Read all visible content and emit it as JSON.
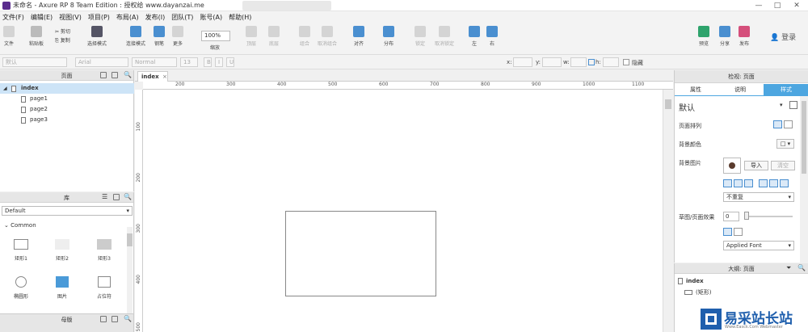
{
  "window": {
    "title": "未命名 - Axure RP 8 Team Edition : 授权给 www.dayanzai.me",
    "controls": [
      "—",
      "□",
      "✕"
    ]
  },
  "menu": [
    "文件(F)",
    "编辑(E)",
    "视图(V)",
    "项目(P)",
    "布局(A)",
    "发布(I)",
    "团队(T)",
    "账号(A)",
    "帮助(H)"
  ],
  "toolbar": {
    "file": "文件",
    "paste": "粘贴板",
    "cut": "剪切",
    "copy": "复制",
    "select": "选择模式",
    "connect": "连接模式",
    "pen": "钢笔",
    "more": "更多",
    "zoom_value": "100%",
    "zoom_label": "缩放",
    "top": "顶层",
    "bottom": "底层",
    "group": "组合",
    "ungroup": "取消组合",
    "align": "对齐",
    "distribute": "分布",
    "lock": "锁定",
    "unlock": "取消锁定",
    "left": "左",
    "right": "右",
    "preview": "预览",
    "share": "分享",
    "publish": "发布",
    "login": "登录"
  },
  "format_bar": {
    "style": "默认",
    "font": "Arial",
    "weight": "Normal",
    "size": "13",
    "x": "x:",
    "y": "y:",
    "w": "w:",
    "h": "h:",
    "hidden": "隐藏"
  },
  "pages_panel": {
    "title": "页面",
    "items": [
      {
        "label": "index",
        "level": 0,
        "selected": true
      },
      {
        "label": "page1",
        "level": 1
      },
      {
        "label": "page2",
        "level": 1
      },
      {
        "label": "page3",
        "level": 1
      }
    ]
  },
  "library_panel": {
    "title": "库",
    "selected_library": "Default",
    "group": "Common",
    "widgets": [
      "矩形1",
      "矩形2",
      "矩形3",
      "椭圆形",
      "图片",
      "占位符"
    ]
  },
  "masters_panel": {
    "title": "母版"
  },
  "canvas": {
    "tab_label": "index",
    "h_ruler": [
      "200",
      "300",
      "400",
      "500",
      "600",
      "700",
      "800",
      "900",
      "1000",
      "1100"
    ],
    "v_ruler": [
      "100",
      "200",
      "300",
      "400",
      "500"
    ]
  },
  "inspector": {
    "title": "检视: 页面",
    "tabs": [
      "属性",
      "说明",
      "样式"
    ],
    "active_tab": "样式",
    "style_name": "默认",
    "page_align_label": "页面排列",
    "bg_color_label": "背景颜色",
    "bg_image_label": "背景图片",
    "import_button": "导入",
    "clear_button": "清空",
    "repeat_option": "不重复",
    "sketch_label": "草图/页面效果",
    "sketch_value": "0",
    "font_option": "Applied Font"
  },
  "outline": {
    "title": "大纲: 页面",
    "items": [
      {
        "label": "index"
      },
      {
        "label": "(矩形)"
      }
    ]
  },
  "watermark": {
    "text": "易采站长站",
    "subtext": "Www.Easck.Com  Webmaster"
  },
  "colors": {
    "accent": "#4a8fd0",
    "selected_row": "#cde4f7",
    "active_tab": "#4da6e0"
  }
}
